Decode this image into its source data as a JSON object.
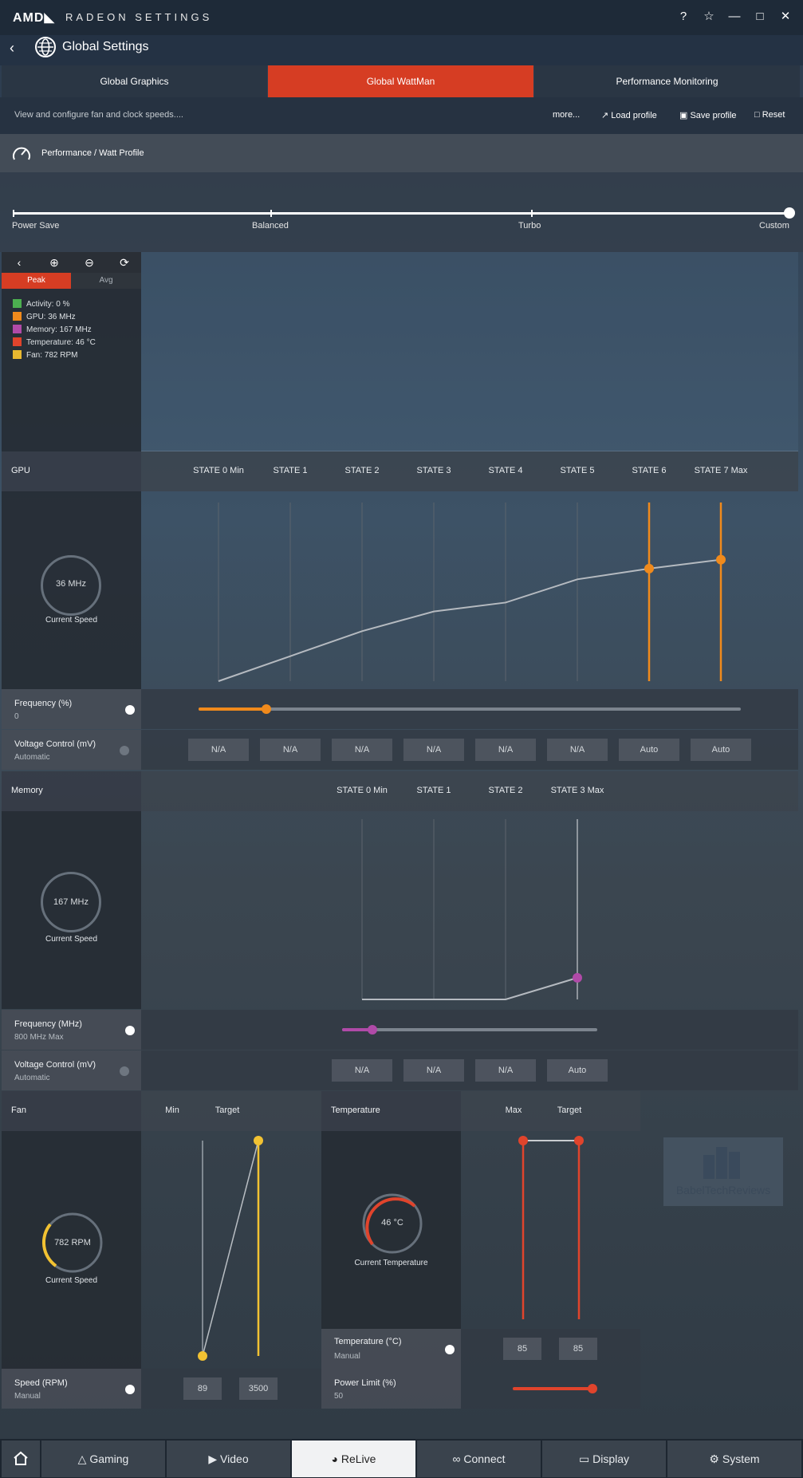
{
  "window": {
    "logo": "AMD◣",
    "title": "RADEON SETTINGS",
    "buttons": [
      "?",
      "☆",
      "—",
      "□",
      "✕"
    ]
  },
  "header": {
    "back": "‹",
    "title": "Global Settings"
  },
  "tabs": [
    {
      "label": "Global Graphics",
      "active": false
    },
    {
      "label": "Global WattMan",
      "active": true
    },
    {
      "label": "Performance Monitoring",
      "active": false
    }
  ],
  "subbar": {
    "description": "View and configure fan and clock speeds....",
    "more": "more...",
    "load_profile": "Load profile",
    "save_profile": "Save profile",
    "reset": "Reset"
  },
  "perf_profile": {
    "title": "Performance / Watt Profile",
    "stops": [
      "Power Save",
      "Balanced",
      "Turbo",
      "Custom"
    ],
    "selected": "Custom"
  },
  "monitor": {
    "tabs": [
      "Peak",
      "Avg"
    ],
    "legend": [
      {
        "label": "Activity: 0 %",
        "color": "#4caf50"
      },
      {
        "label": "GPU: 36 MHz",
        "color": "#f08a1c"
      },
      {
        "label": "Memory: 167 MHz",
        "color": "#b04aa8"
      },
      {
        "label": "Temperature: 46 °C",
        "color": "#e0442c"
      },
      {
        "label": "Fan: 782 RPM",
        "color": "#e8b830"
      }
    ]
  },
  "gpu": {
    "section": "GPU",
    "states": [
      "STATE 0 Min",
      "STATE 1",
      "STATE 2",
      "STATE 3",
      "STATE 4",
      "STATE 5",
      "STATE 6",
      "STATE 7 Max"
    ],
    "curve": [
      0.0,
      0.14,
      0.28,
      0.39,
      0.44,
      0.57,
      0.63,
      0.68
    ],
    "active_states": [
      6,
      7
    ],
    "current_speed_value": "36 MHz",
    "current_speed_label": "Current Speed",
    "frequency_label": "Frequency (%)",
    "frequency_value": "0",
    "frequency_slider": 0.125,
    "voltage_label": "Voltage Control (mV)",
    "voltage_value": "Automatic",
    "voltages": [
      "N/A",
      "N/A",
      "N/A",
      "N/A",
      "N/A",
      "N/A",
      "Auto",
      "Auto"
    ]
  },
  "memory": {
    "section": "Memory",
    "states": [
      "STATE 0 Min",
      "STATE 1",
      "STATE 2",
      "STATE 3 Max"
    ],
    "curve": [
      0.0,
      0.0,
      0.0,
      0.12
    ],
    "current_speed_value": "167 MHz",
    "current_speed_label": "Current Speed",
    "frequency_label": "Frequency (MHz)",
    "frequency_value": "800 MHz Max",
    "frequency_slider": 0.12,
    "voltage_label": "Voltage Control (mV)",
    "voltage_value": "Automatic",
    "voltages": [
      "N/A",
      "N/A",
      "N/A",
      "Auto"
    ]
  },
  "fan": {
    "section": "Fan",
    "cols": [
      "Min",
      "Target"
    ],
    "current_speed_value": "782 RPM",
    "current_speed_label": "Current Speed",
    "speed_label": "Speed (RPM)",
    "speed_mode": "Manual",
    "min_value": "89",
    "target_value": "3500"
  },
  "temperature": {
    "section": "Temperature",
    "cols": [
      "Max",
      "Target"
    ],
    "current_value": "46 °C",
    "current_label": "Current Temperature",
    "temp_label": "Temperature (°C)",
    "temp_mode": "Manual",
    "max_value": "85",
    "target_value": "85",
    "power_label": "Power Limit (%)",
    "power_value": "50"
  },
  "watermark": "BabelTechReviews",
  "bottom_nav": [
    {
      "label": "",
      "icon": "home-icon"
    },
    {
      "label": "Gaming",
      "icon": "gamepad-icon"
    },
    {
      "label": "Video",
      "icon": "play-icon"
    },
    {
      "label": "ReLive",
      "icon": "relive-icon"
    },
    {
      "label": "Connect",
      "icon": "connect-icon"
    },
    {
      "label": "Display",
      "icon": "monitor-icon"
    },
    {
      "label": "System",
      "icon": "gear-icon"
    }
  ],
  "colors": {
    "accent": "#d63d23",
    "gpu": "#f08a1c",
    "memory": "#b04aa8",
    "fan": "#f2c232",
    "temp": "#e0442c"
  }
}
